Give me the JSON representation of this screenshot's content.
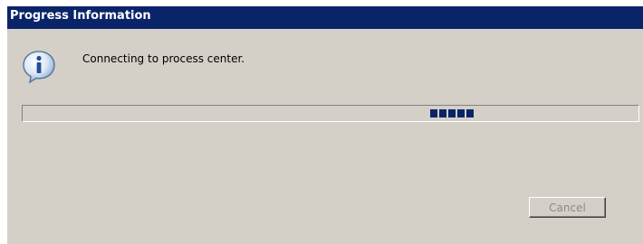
{
  "dialog": {
    "title": "Progress Information",
    "message": "Connecting to process center.",
    "icon": "information-icon",
    "cancel_label": "Cancel",
    "cancel_enabled": false,
    "progress": {
      "mode": "indeterminate",
      "segments": 5
    }
  },
  "colors": {
    "title_bar": "#0a246a",
    "dialog_background": "#d4d0c8",
    "progress_block": "#0a246a",
    "disabled_text": "#8d8a85"
  }
}
